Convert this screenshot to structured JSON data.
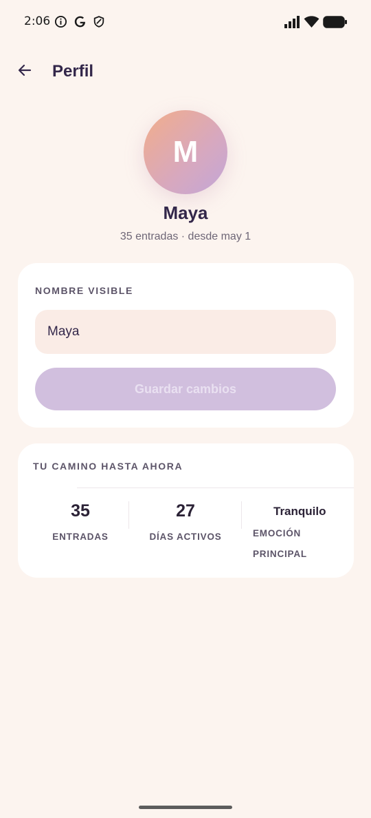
{
  "status_bar": {
    "time": "2:06",
    "icons": [
      "info-icon",
      "google-icon",
      "shield-icon",
      "signal-icon",
      "wifi-icon",
      "battery-icon"
    ]
  },
  "app_bar": {
    "back_icon": "arrow-back-icon",
    "title": "Perfil"
  },
  "profile": {
    "avatar_initial": "M",
    "name": "Maya",
    "meta": "35 entradas · desde may 1"
  },
  "name_card": {
    "label": "NOMBRE VISIBLE",
    "input_value": "Maya",
    "save_label": "Guardar cambios"
  },
  "stats_card": {
    "title": "TU CAMINO HASTA AHORA",
    "stats": [
      {
        "value": "35",
        "label": "ENTRADAS"
      },
      {
        "value": "27",
        "label": "DÍAS ACTIVOS"
      },
      {
        "value": "Tranquilo",
        "label_line1": "EMOCIÓN",
        "label_line2": "PRINCIPAL"
      }
    ]
  },
  "colors": {
    "background": "#fcf4ef",
    "primary_text": "#33274a",
    "button_disabled": "#d1bfde",
    "input_bg": "#faece6"
  }
}
